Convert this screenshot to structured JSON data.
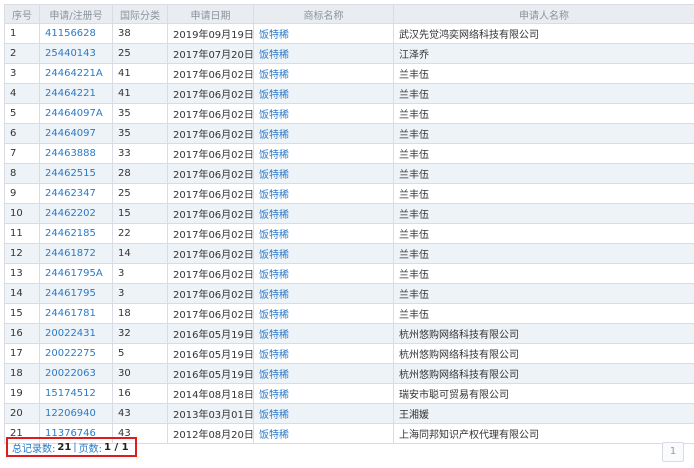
{
  "headers": [
    "序号",
    "申请/注册号",
    "国际分类",
    "申请日期",
    "商标名称",
    "申请人名称"
  ],
  "rows": [
    [
      "1",
      "41156628",
      "38",
      "2019年09月19日",
      "饭特稀",
      "武汉先觉鸿奕网络科技有限公司"
    ],
    [
      "2",
      "25440143",
      "25",
      "2017年07月20日",
      "饭特稀",
      "江泽乔"
    ],
    [
      "3",
      "24464221A",
      "41",
      "2017年06月02日",
      "饭特稀",
      "兰丰伍"
    ],
    [
      "4",
      "24464221",
      "41",
      "2017年06月02日",
      "饭特稀",
      "兰丰伍"
    ],
    [
      "5",
      "24464097A",
      "35",
      "2017年06月02日",
      "饭特稀",
      "兰丰伍"
    ],
    [
      "6",
      "24464097",
      "35",
      "2017年06月02日",
      "饭特稀",
      "兰丰伍"
    ],
    [
      "7",
      "24463888",
      "33",
      "2017年06月02日",
      "饭特稀",
      "兰丰伍"
    ],
    [
      "8",
      "24462515",
      "28",
      "2017年06月02日",
      "饭特稀",
      "兰丰伍"
    ],
    [
      "9",
      "24462347",
      "25",
      "2017年06月02日",
      "饭特稀",
      "兰丰伍"
    ],
    [
      "10",
      "24462202",
      "15",
      "2017年06月02日",
      "饭特稀",
      "兰丰伍"
    ],
    [
      "11",
      "24462185",
      "22",
      "2017年06月02日",
      "饭特稀",
      "兰丰伍"
    ],
    [
      "12",
      "24461872",
      "14",
      "2017年06月02日",
      "饭特稀",
      "兰丰伍"
    ],
    [
      "13",
      "24461795A",
      "3",
      "2017年06月02日",
      "饭特稀",
      "兰丰伍"
    ],
    [
      "14",
      "24461795",
      "3",
      "2017年06月02日",
      "饭特稀",
      "兰丰伍"
    ],
    [
      "15",
      "24461781",
      "18",
      "2017年06月02日",
      "饭特稀",
      "兰丰伍"
    ],
    [
      "16",
      "20022431",
      "32",
      "2016年05月19日",
      "饭特稀",
      "杭州悠购网络科技有限公司"
    ],
    [
      "17",
      "20022275",
      "5",
      "2016年05月19日",
      "饭特稀",
      "杭州悠购网络科技有限公司"
    ],
    [
      "18",
      "20022063",
      "30",
      "2016年05月19日",
      "饭特稀",
      "杭州悠购网络科技有限公司"
    ],
    [
      "19",
      "15174512",
      "16",
      "2014年08月18日",
      "饭特稀",
      "瑞安市聪可贸易有限公司"
    ],
    [
      "20",
      "12206940",
      "43",
      "2013年03月01日",
      "饭特稀",
      "王湘媛"
    ],
    [
      "21",
      "11376746",
      "43",
      "2012年08月20日",
      "饭特稀",
      "上海同邦知识产权代理有限公司"
    ]
  ],
  "footer": {
    "total_label": "总记录数:",
    "total_value": "21",
    "separator": "|",
    "pages_label": "页数:",
    "pages_value": "1 / 1"
  },
  "pager": {
    "page_button": "1"
  }
}
